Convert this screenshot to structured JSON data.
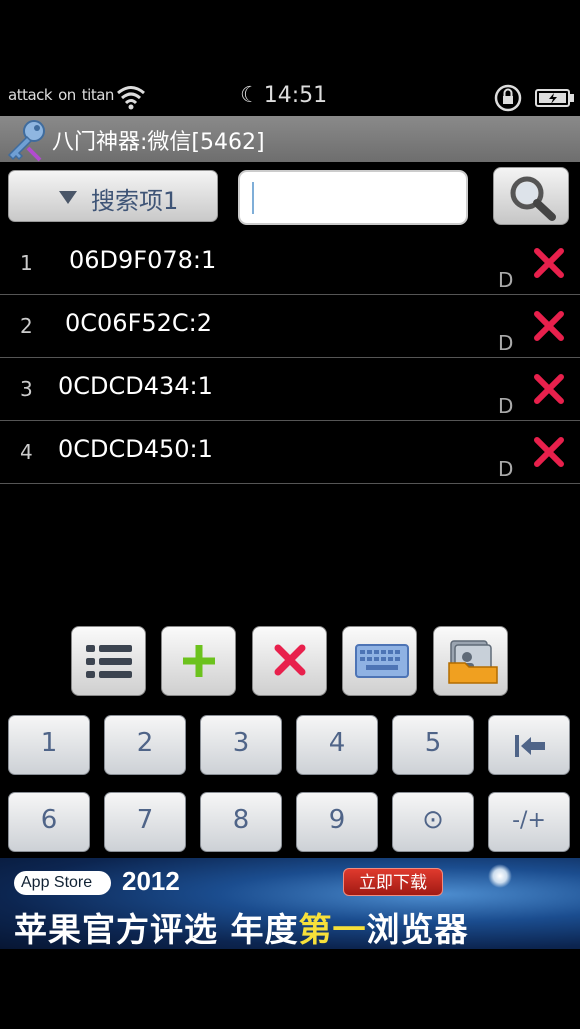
{
  "status_bar": {
    "carriers": [
      "attack",
      "on",
      "titan"
    ],
    "time": "14:51"
  },
  "title_bar": {
    "title": "八门神器:微信[5462]"
  },
  "search": {
    "dropdown_label": "搜索项1",
    "input_value": ""
  },
  "results": [
    {
      "index": "1",
      "address": "06D9F078:",
      "value": "1",
      "type": "D"
    },
    {
      "index": "2",
      "address": "0C06F52C:",
      "value": "2",
      "type": "D"
    },
    {
      "index": "3",
      "address": "0CDCD434:",
      "value": "1",
      "type": "D"
    },
    {
      "index": "4",
      "address": "0CDCD450:",
      "value": "1",
      "type": "D"
    }
  ],
  "toolbar": {
    "icons": [
      "list-icon",
      "plus-icon",
      "delete-icon",
      "keyboard-icon",
      "contacts-folder-icon"
    ]
  },
  "keypad": {
    "row1": [
      "1",
      "2",
      "3",
      "4",
      "5",
      "|←"
    ],
    "row2": [
      "6",
      "7",
      "8",
      "9",
      "⊙",
      "-/+"
    ]
  },
  "ad": {
    "badge": "App Store",
    "year": "2012",
    "button": "立即下载",
    "slogan_pre": "苹果官方评选  年度",
    "slogan_hl": "第一",
    "slogan_post": "浏览器"
  },
  "colors": {
    "delete_red": "#e8204c",
    "plus_green": "#6cc21d",
    "key_text": "#4f6488"
  }
}
